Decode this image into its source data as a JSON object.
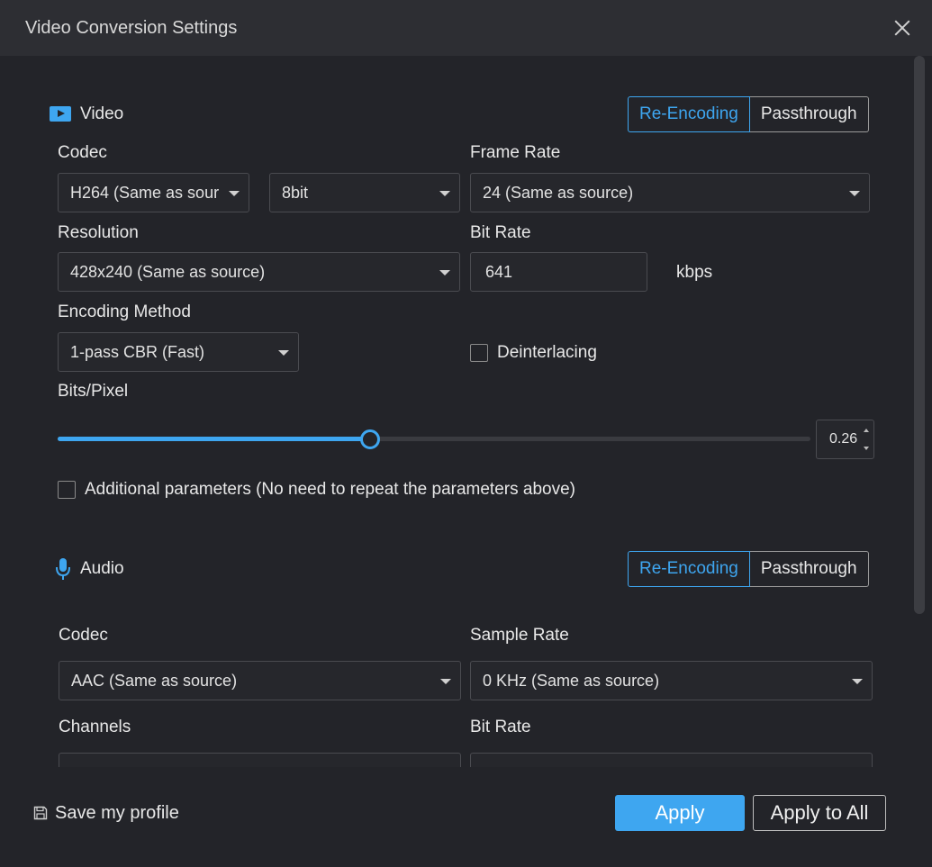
{
  "window": {
    "title": "Video Conversion Settings"
  },
  "video": {
    "section_title": "Video",
    "mode_options": [
      "Re-Encoding",
      "Passthrough"
    ],
    "codec_label": "Codec",
    "codec_value": "H264 (Same as sour",
    "bitdepth_value": "8bit",
    "framerate_label": "Frame Rate",
    "framerate_value": "24 (Same as source)",
    "resolution_label": "Resolution",
    "resolution_value": "428x240 (Same as source)",
    "bitrate_label": "Bit Rate",
    "bitrate_value": "641",
    "bitrate_unit": "kbps",
    "encoding_label": "Encoding Method",
    "encoding_value": "1-pass CBR (Fast)",
    "deinterlacing_label": "Deinterlacing",
    "bpp_label": "Bits/Pixel",
    "bpp_value": "0.26",
    "bpp_slider_fraction": 0.415,
    "additional_label": "Additional parameters (No need to repeat the parameters above)"
  },
  "audio": {
    "section_title": "Audio",
    "mode_options": [
      "Re-Encoding",
      "Passthrough"
    ],
    "codec_label": "Codec",
    "codec_value": "AAC (Same as source)",
    "samplerate_label": "Sample Rate",
    "samplerate_value": "0 KHz (Same as source)",
    "channels_label": "Channels",
    "bitrate_label": "Bit Rate"
  },
  "footer": {
    "save_profile": "Save my profile",
    "apply": "Apply",
    "apply_all": "Apply to All"
  },
  "colors": {
    "accent": "#3ea6f0",
    "background": "#232429",
    "titlebar": "#2d2e33"
  }
}
